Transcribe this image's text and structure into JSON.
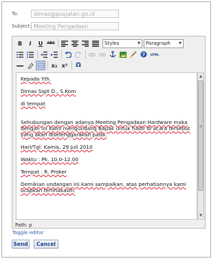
{
  "to": {
    "label": "To:",
    "value": "dimas@pusjatan.go.id"
  },
  "subject": {
    "label": "Subject:",
    "value": "Meeting Pengadaan"
  },
  "toolbar": {
    "bold": "B",
    "italic": "I",
    "underline": "U",
    "strike": "ABC",
    "styles_select": "Styles",
    "format_select": "Paragraph",
    "subscript": "x₂",
    "superscript": "x²",
    "omega": "Ω",
    "html": "HTML"
  },
  "icons": [
    "align-left-icon",
    "align-center-icon",
    "align-right-icon",
    "align-justify-icon",
    "bullet-list-icon",
    "number-list-icon",
    "outdent-icon",
    "indent-icon",
    "undo-icon",
    "redo-icon",
    "link-icon",
    "unlink-icon",
    "anchor-icon",
    "image-icon",
    "cleanup-icon",
    "help-icon",
    "html-icon",
    "horizontal-rule-icon",
    "remove-format-icon",
    "visual-aid-icon"
  ],
  "body": {
    "p1": "Kepada Yth.",
    "p2": "Dimas Sigit D., S.Kom",
    "p3": "di tempat",
    "p4": "Sehubungan dengan adanya Meeting Pengadaan Hardware maka dengan ini kami mengundang Bapak untuk hadir di acara tersebut yang akan diselenggarakan pada:",
    "p5": "Hari/Tgl: Kamis, 29 Juli 2010",
    "p6": "Waktu  : Pk. 10.0-12.00",
    "p7": "Tempat : R. Proker",
    "p8": "Demikian undangan ini kami sampaikan, atas perhatiannya kami ucapkan terimakasih."
  },
  "path_bar": "Path: p",
  "toggle_editor": "Toggle editor",
  "buttons": {
    "send": "Send",
    "cancel": "Cancel"
  }
}
